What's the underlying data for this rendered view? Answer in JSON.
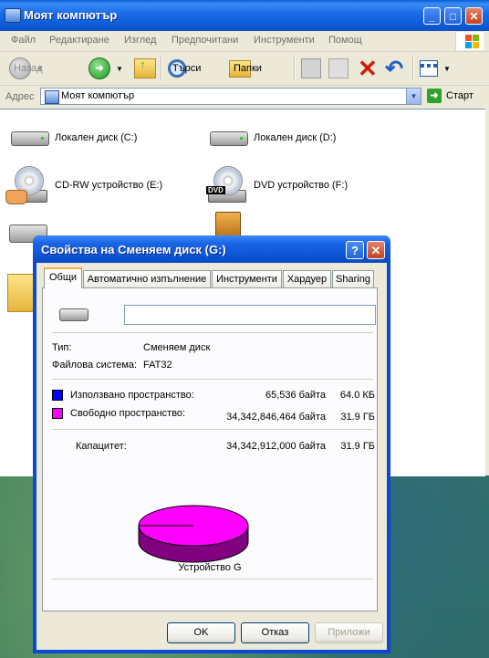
{
  "explorer": {
    "title": "Моят компютър",
    "menu": [
      "Файл",
      "Редактиране",
      "Изглед",
      "Предпочитани",
      "Инструменти",
      "Помощ"
    ],
    "toolbar": {
      "back": "Назад",
      "search": "Търси",
      "folders": "Папки"
    },
    "address": {
      "label": "Адрес",
      "value": "Моят компютър",
      "go": "Старт"
    },
    "drives": [
      {
        "label": "Локален диск (C:)",
        "icon": "hard-drive-icon"
      },
      {
        "label": "Локален диск (D:)",
        "icon": "hard-drive-icon"
      },
      {
        "label": "CD-RW устройство (E:)",
        "icon": "cd-drive-icon"
      },
      {
        "label": "DVD устройство (F:)",
        "icon": "dvd-drive-icon"
      }
    ]
  },
  "dialog": {
    "title": "Свойства на Сменяем диск (G:)",
    "help": "?",
    "close": "✕",
    "tabs": [
      "Общи",
      "Автоматично изпълнение",
      "Инструменти",
      "Хардуер",
      "Sharing"
    ],
    "active_tab": "Общи",
    "name_value": "",
    "type_label": "Тип:",
    "type_value": "Сменяем диск",
    "fs_label": "Файлова система:",
    "fs_value": "FAT32",
    "used": {
      "label": "Използвано пространство:",
      "bytes": "65,536 байта",
      "size": "64.0 КБ",
      "color": "#0000ff"
    },
    "free": {
      "label": "Свободно пространство:",
      "bytes": "34,342,846,464 байта",
      "size": "31.9 ГБ",
      "color": "#ff00ff"
    },
    "capacity": {
      "label": "Капацитет:",
      "bytes": "34,342,912,000 байта",
      "size": "31.9 ГБ"
    },
    "pie_fraction_used": 1.9e-06,
    "device_label": "Устройство G",
    "buttons": {
      "ok": "OK",
      "cancel": "Отказ",
      "apply": "Приложи"
    }
  }
}
